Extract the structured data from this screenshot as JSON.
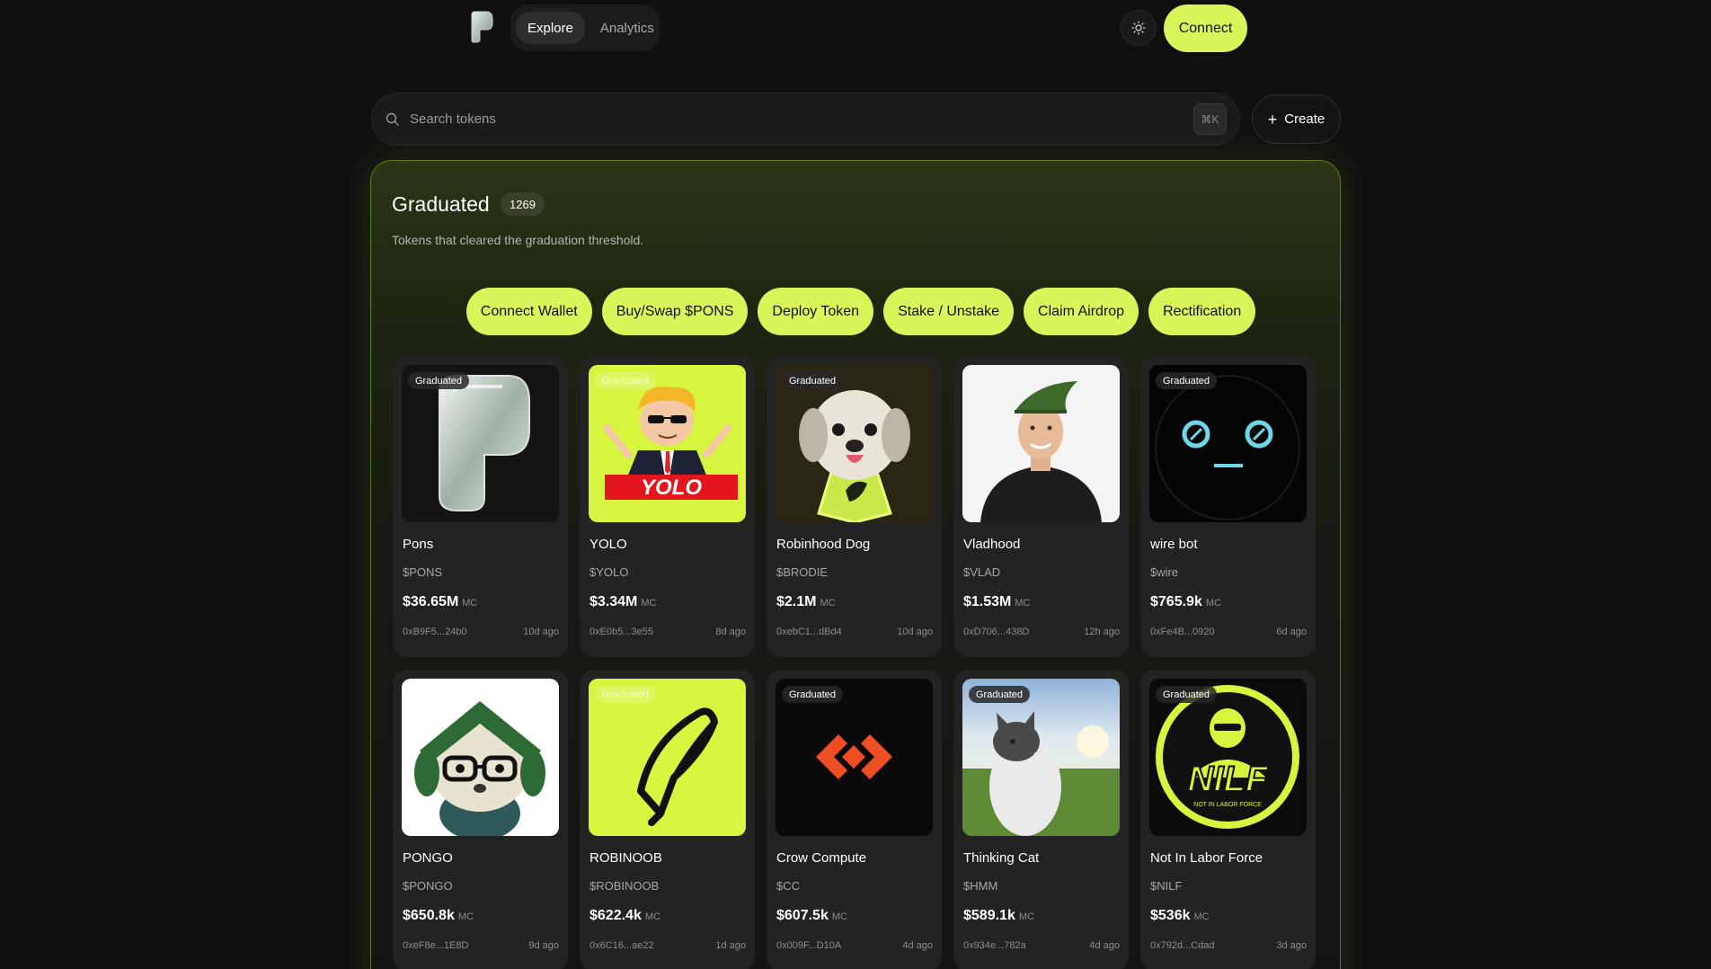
{
  "nav": {
    "tabs": [
      {
        "label": "Explore",
        "active": true
      },
      {
        "label": "Analytics",
        "active": false
      }
    ],
    "connect_label": "Connect",
    "theme_icon": "sun-icon"
  },
  "search": {
    "placeholder": "Search tokens",
    "shortcut": "⌘K",
    "create_label": "Create"
  },
  "panel": {
    "title": "Graduated",
    "count": "1269",
    "subtitle": "Tokens that cleared the graduation threshold.",
    "actions": [
      "Connect Wallet",
      "Buy/Swap $PONS",
      "Deploy Token",
      "Stake / Unstake",
      "Claim Airdrop",
      "Rectification"
    ]
  },
  "colors": {
    "accent": "#d8f55a",
    "background": "#101010",
    "card": "#232323",
    "panel_border": "#5f7a1e"
  },
  "tokens": [
    {
      "name": "Pons",
      "ticker": "$PONS",
      "mc": "$36.65M",
      "mc_label": "MC",
      "address": "0xB9F5...24b0",
      "age": "10d ago",
      "badge": "Graduated",
      "image": "pons-logo-image"
    },
    {
      "name": "YOLO",
      "ticker": "$YOLO",
      "mc": "$3.34M",
      "mc_label": "MC",
      "address": "0xE0b5...3e55",
      "age": "8d ago",
      "badge": "Graduated",
      "image": "yolo-mascot-image"
    },
    {
      "name": "Robinhood Dog",
      "ticker": "$BRODIE",
      "mc": "$2.1M",
      "mc_label": "MC",
      "address": "0xebC1...dBd4",
      "age": "10d ago",
      "badge": "Graduated",
      "image": "dog-image"
    },
    {
      "name": "Vladhood",
      "ticker": "$VLAD",
      "mc": "$1.53M",
      "mc_label": "MC",
      "address": "0xD706...438D",
      "age": "12h ago",
      "badge": "Graduated",
      "image": "man-green-hat-image"
    },
    {
      "name": "wire bot",
      "ticker": "$wire",
      "mc": "$765.9k",
      "mc_label": "MC",
      "address": "0xFe4B...0920",
      "age": "6d ago",
      "badge": "Graduated",
      "image": "robot-face-image"
    },
    {
      "name": "PONGO",
      "ticker": "$PONGO",
      "mc": "$650.8k",
      "mc_label": "MC",
      "address": "0xeF8e...1E8D",
      "age": "9d ago",
      "badge": "",
      "image": "plush-dog-image"
    },
    {
      "name": "ROBINOOB",
      "ticker": "$ROBINOOB",
      "mc": "$622.4k",
      "mc_label": "MC",
      "address": "0x6C16...ae22",
      "age": "1d ago",
      "badge": "Graduated",
      "image": "feather-logo-image"
    },
    {
      "name": "Crow Compute",
      "ticker": "$CC",
      "mc": "$607.5k",
      "mc_label": "MC",
      "address": "0x009F...D10A",
      "age": "4d ago",
      "badge": "Graduated",
      "image": "crow-compute-logo-image"
    },
    {
      "name": "Thinking Cat",
      "ticker": "$HMM",
      "mc": "$589.1k",
      "mc_label": "MC",
      "address": "0x934e...782a",
      "age": "4d ago",
      "badge": "Graduated",
      "image": "thinking-cat-image"
    },
    {
      "name": "Not In Labor Force",
      "ticker": "$NILF",
      "mc": "$536k",
      "mc_label": "MC",
      "address": "0x792d...Cdad",
      "age": "3d ago",
      "badge": "Graduated",
      "image": "nilf-logo-image"
    }
  ],
  "nilf_art_text": {
    "big": "NILF",
    "ring": "NOT IN LABOR FORCE"
  },
  "yolo_art_text": "YOLO"
}
